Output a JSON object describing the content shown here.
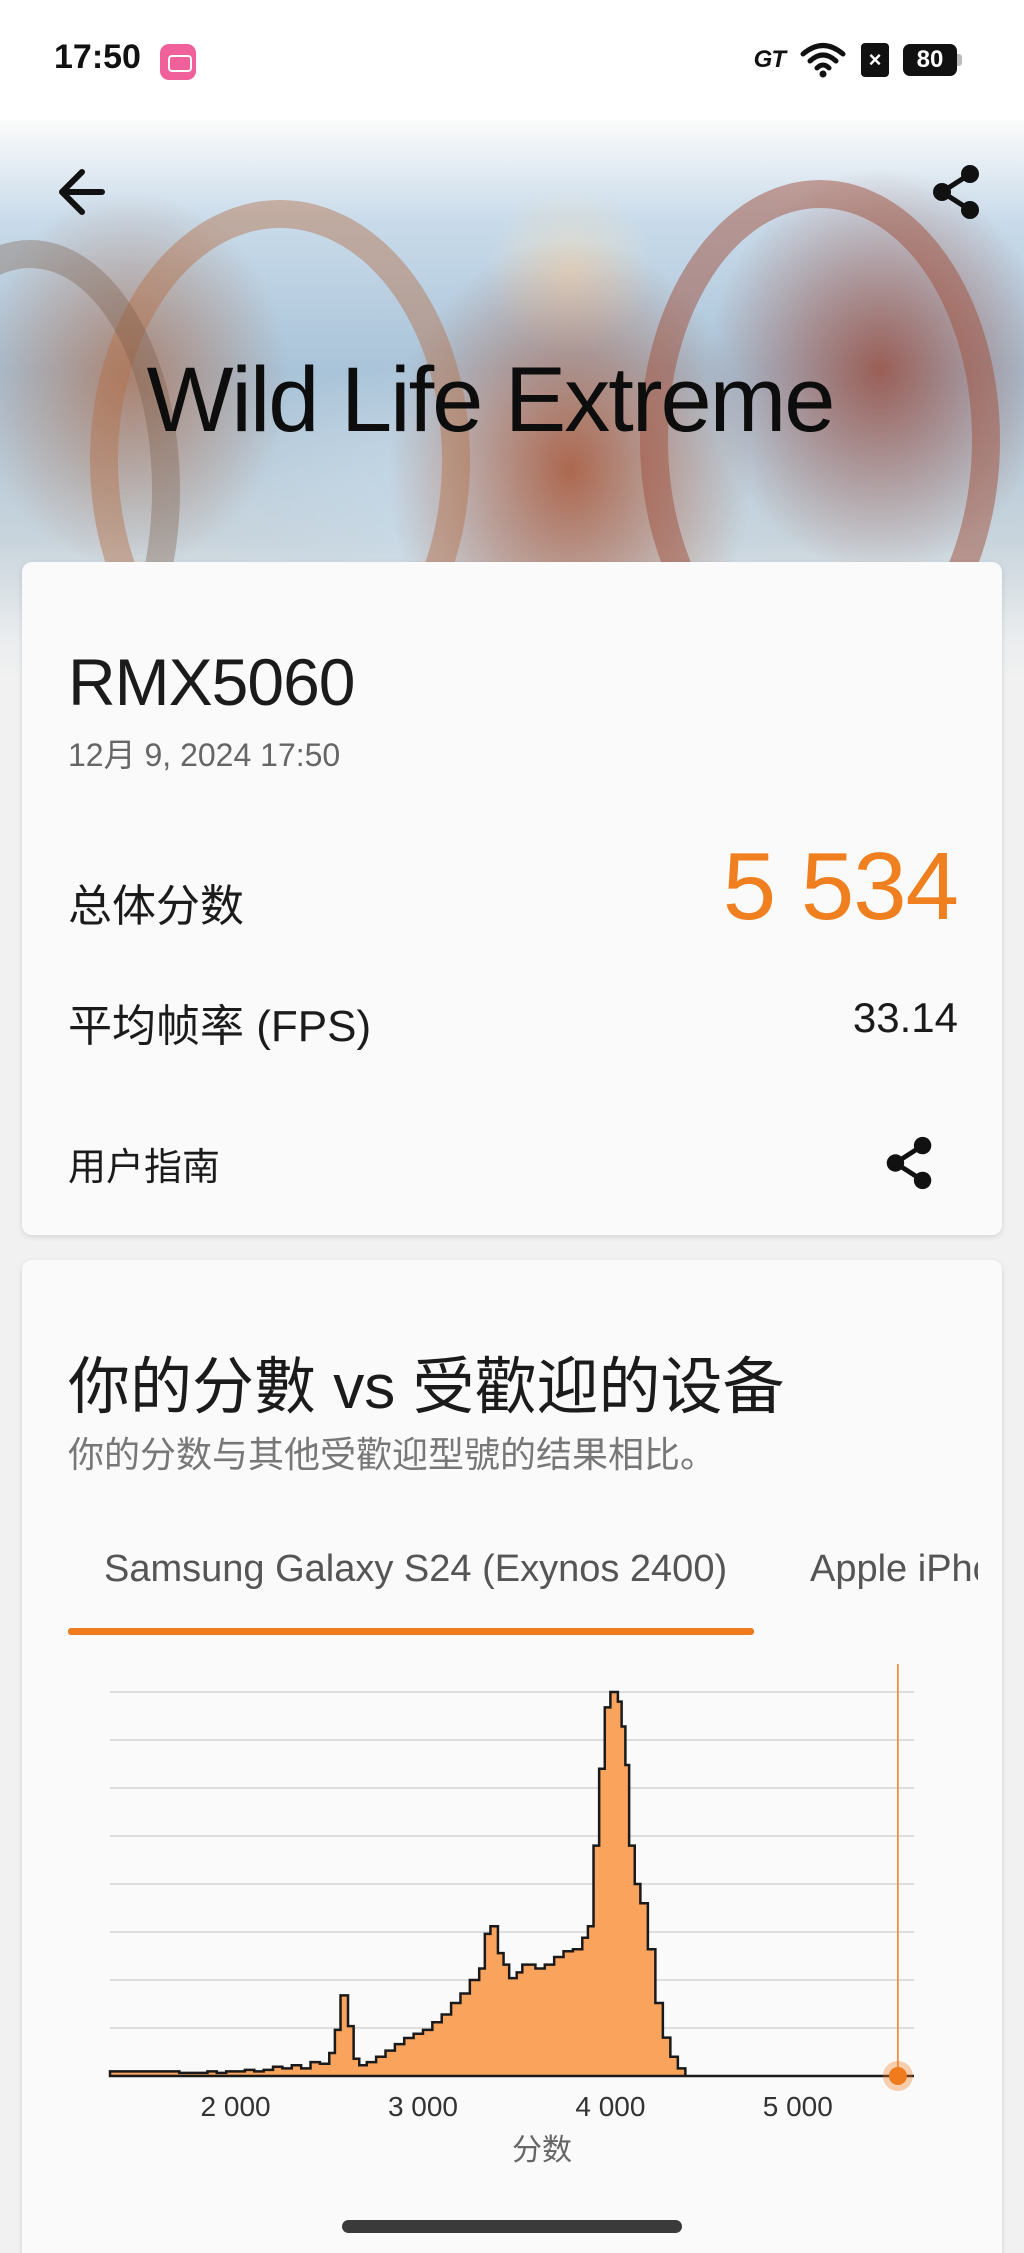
{
  "status_bar": {
    "time": "17:50",
    "network_badge": "GT",
    "battery": "80",
    "icons": [
      "app-notification-icon",
      "wifi-icon",
      "no-sim-icon",
      "battery-icon"
    ]
  },
  "header": {
    "title": "Wild Life Extreme",
    "back_icon": "arrow-left-icon",
    "share_icon": "share-icon"
  },
  "result": {
    "device": "RMX5060",
    "date": "12月 9, 2024 17:50",
    "score_label": "总体分数",
    "score_value": "5 534",
    "fps_label": "平均帧率 (FPS)",
    "fps_value": "33.14",
    "guide_label": "用户指南"
  },
  "comparison": {
    "title": "你的分數 vs 受歡迎的设备",
    "subtitle": "你的分数与其他受歡迎型號的结果相比。",
    "tabs": [
      {
        "label": "Samsung Galaxy S24 (Exynos 2400)",
        "active": true
      },
      {
        "label": "Apple iPhc",
        "active": false
      }
    ]
  },
  "colors": {
    "accent": "#ef7b1c",
    "score": "#f07f1f",
    "histogram_fill": "#f9a35d",
    "histogram_stroke": "#1a1a1a"
  },
  "chart_data": {
    "type": "area",
    "xlabel": "分数",
    "x_ticks": [
      "2 000",
      "3 000",
      "4 000",
      "5 000"
    ],
    "xlim": [
      1330,
      5620
    ],
    "your_score": 5534,
    "x": [
      1330,
      1400,
      1500,
      1600,
      1700,
      1800,
      1850,
      1900,
      1950,
      2000,
      2050,
      2100,
      2150,
      2200,
      2250,
      2300,
      2350,
      2400,
      2450,
      2500,
      2530,
      2560,
      2600,
      2630,
      2660,
      2700,
      2750,
      2800,
      2850,
      2900,
      2950,
      3000,
      3050,
      3100,
      3150,
      3200,
      3250,
      3300,
      3330,
      3360,
      3400,
      3430,
      3460,
      3500,
      3530,
      3560,
      3600,
      3650,
      3700,
      3750,
      3800,
      3850,
      3880,
      3910,
      3940,
      3970,
      4000,
      4020,
      4040,
      4060,
      4080,
      4100,
      4130,
      4160,
      4200,
      4240,
      4280,
      4320,
      4360,
      4400,
      4450,
      4500,
      4550,
      4600,
      5000,
      5500,
      5620
    ],
    "y": [
      0.012,
      0.012,
      0.012,
      0.012,
      0.008,
      0.008,
      0.012,
      0.008,
      0.012,
      0.012,
      0.016,
      0.012,
      0.016,
      0.024,
      0.02,
      0.028,
      0.02,
      0.036,
      0.032,
      0.06,
      0.12,
      0.21,
      0.13,
      0.045,
      0.028,
      0.036,
      0.05,
      0.066,
      0.083,
      0.099,
      0.11,
      0.12,
      0.14,
      0.16,
      0.19,
      0.215,
      0.25,
      0.28,
      0.37,
      0.39,
      0.32,
      0.29,
      0.255,
      0.27,
      0.29,
      0.29,
      0.28,
      0.29,
      0.31,
      0.325,
      0.33,
      0.36,
      0.39,
      0.6,
      0.8,
      0.96,
      1.0,
      1.0,
      0.975,
      0.91,
      0.81,
      0.6,
      0.5,
      0.45,
      0.33,
      0.19,
      0.1,
      0.05,
      0.02,
      0.0,
      0.0,
      0.0,
      0.0,
      0.0,
      0.0,
      0.0,
      0.0
    ]
  }
}
